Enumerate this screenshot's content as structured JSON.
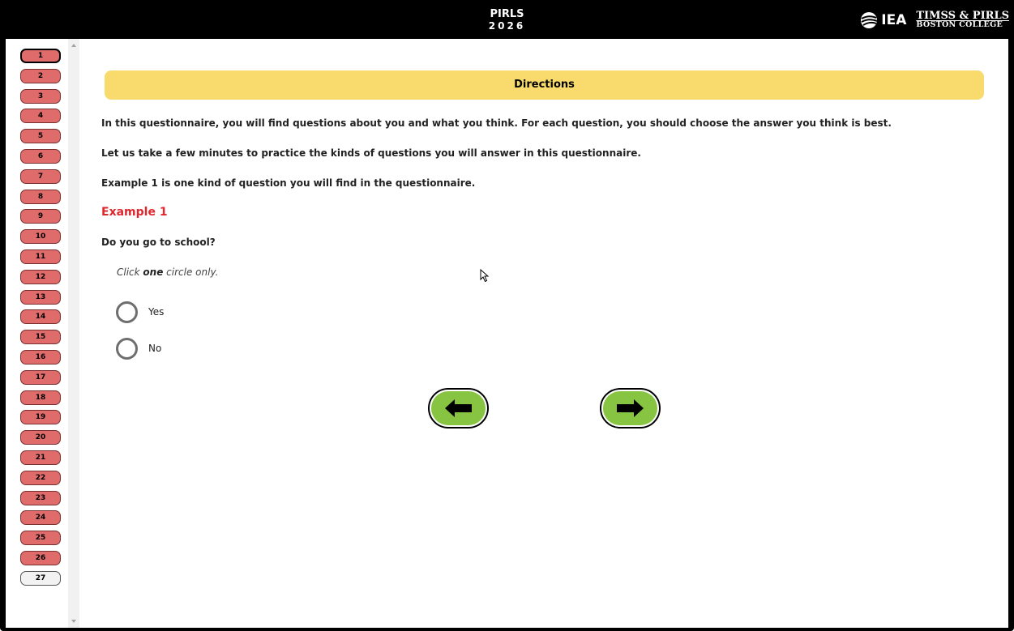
{
  "header": {
    "title_line1": "PIRLS",
    "title_line2": "2026",
    "logo_iea": "IEA",
    "logo_timss_line1": "TIMSS & PIRLS",
    "logo_timss_line2": "BOSTON COLLEGE"
  },
  "sidebar": {
    "current_item": "1",
    "items": [
      {
        "label": "1",
        "state": "answered-current"
      },
      {
        "label": "2",
        "state": "answered"
      },
      {
        "label": "3",
        "state": "answered"
      },
      {
        "label": "4",
        "state": "answered"
      },
      {
        "label": "5",
        "state": "answered"
      },
      {
        "label": "6",
        "state": "answered"
      },
      {
        "label": "7",
        "state": "answered"
      },
      {
        "label": "8",
        "state": "answered"
      },
      {
        "label": "9",
        "state": "answered"
      },
      {
        "label": "10",
        "state": "answered"
      },
      {
        "label": "11",
        "state": "answered"
      },
      {
        "label": "12",
        "state": "answered"
      },
      {
        "label": "13",
        "state": "answered"
      },
      {
        "label": "14",
        "state": "answered"
      },
      {
        "label": "15",
        "state": "answered"
      },
      {
        "label": "16",
        "state": "answered"
      },
      {
        "label": "17",
        "state": "answered"
      },
      {
        "label": "18",
        "state": "answered"
      },
      {
        "label": "19",
        "state": "answered"
      },
      {
        "label": "20",
        "state": "answered"
      },
      {
        "label": "21",
        "state": "answered"
      },
      {
        "label": "22",
        "state": "answered"
      },
      {
        "label": "23",
        "state": "answered"
      },
      {
        "label": "24",
        "state": "answered"
      },
      {
        "label": "25",
        "state": "answered"
      },
      {
        "label": "26",
        "state": "answered"
      },
      {
        "label": "27",
        "state": "unvisited"
      }
    ]
  },
  "main": {
    "directions_title": "Directions",
    "paragraph1": "In this questionnaire, you will find questions about you and what you think. For each question, you should choose the answer you think is best.",
    "paragraph2": "Let us take a few minutes to practice the kinds of questions you will answer in this questionnaire.",
    "paragraph3": "Example 1 is one kind of question you will find in the questionnaire.",
    "example_label": "Example 1",
    "question": "Do you go to school?",
    "instruction_pre": "Click ",
    "instruction_emph": "one",
    "instruction_post": " circle only.",
    "options": [
      {
        "label": "Yes",
        "selected": false
      },
      {
        "label": "No",
        "selected": false
      }
    ]
  },
  "navigation": {
    "back_icon": "arrow-left-icon",
    "next_icon": "arrow-right-icon"
  },
  "colors": {
    "nav_answered": "#e06b6b",
    "nav_unvisited": "#f2f2f2",
    "directions_bar": "#f8db6c",
    "example_label": "#e0262d",
    "arrow_button": "#86c442"
  }
}
